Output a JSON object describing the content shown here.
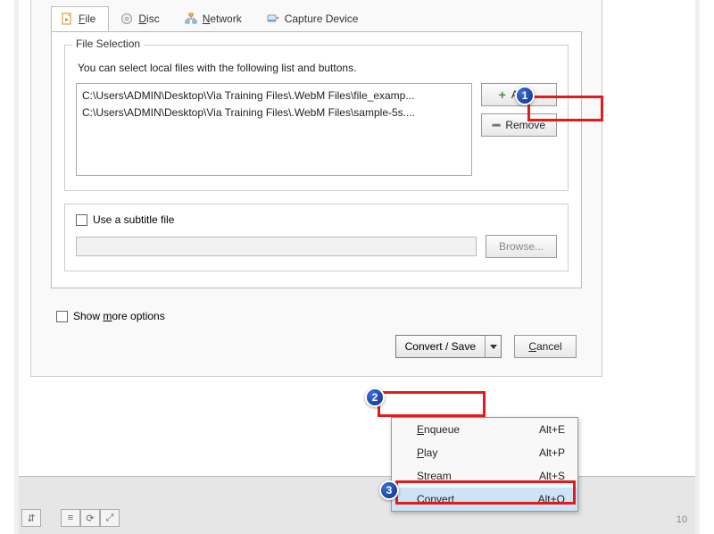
{
  "tabs": {
    "file": "File",
    "disc": "Disc",
    "network": "Network",
    "capture": "Capture Device"
  },
  "fileSelection": {
    "legend": "File Selection",
    "helper": "You can select local files with the following list and buttons.",
    "files": [
      "C:\\Users\\ADMIN\\Desktop\\Via Training Files\\.WebM Files\\file_examp...",
      "C:\\Users\\ADMIN\\Desktop\\Via Training Files\\.WebM Files\\sample-5s...."
    ],
    "addLabel": "Add...",
    "removeLabel": "Remove"
  },
  "subtitle": {
    "checkboxLabel": "Use a subtitle file",
    "browseLabel": "Browse..."
  },
  "showMore": "Show more options",
  "actions": {
    "convertSave": "Convert / Save",
    "cancel": "Cancel"
  },
  "menu": {
    "items": [
      {
        "label": "Enqueue",
        "accel": "Alt+E",
        "ukey": "E"
      },
      {
        "label": "Play",
        "accel": "Alt+P",
        "ukey": "P"
      },
      {
        "label": "Stream",
        "accel": "Alt+S",
        "ukey": "S"
      },
      {
        "label": "Convert",
        "accel": "Alt+O",
        "ukey": "o"
      }
    ]
  },
  "callouts": {
    "one": "1",
    "two": "2",
    "three": "3"
  },
  "pageNumber": "10"
}
